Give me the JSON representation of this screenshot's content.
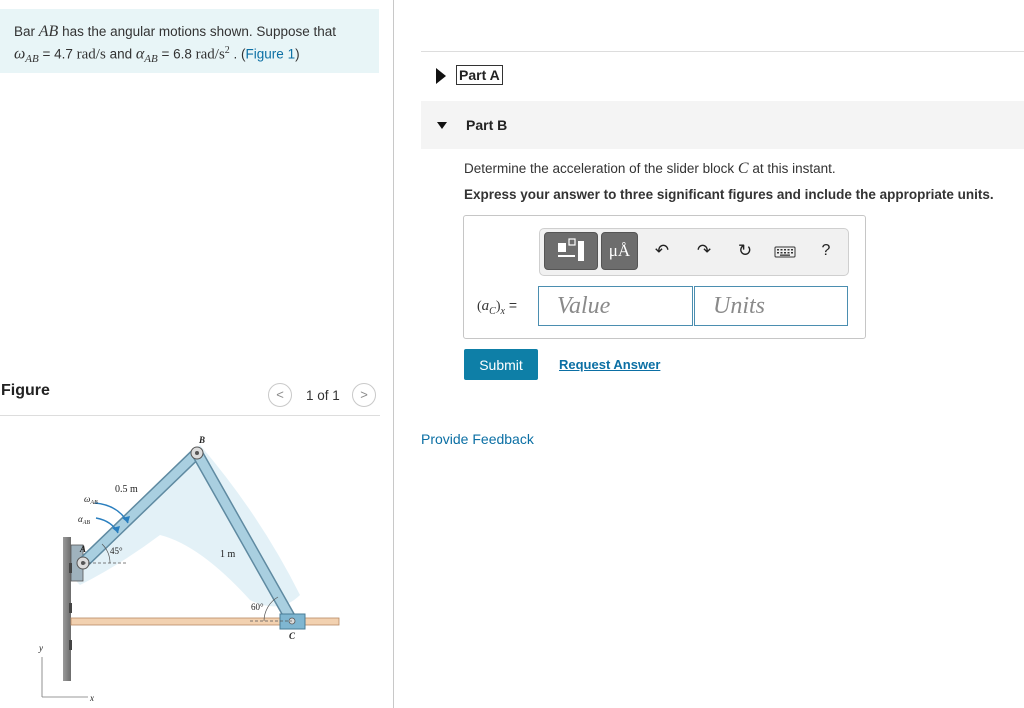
{
  "problem": {
    "text_1": "Bar ",
    "var_ab": "AB",
    "text_2": " has the angular motions shown. Suppose that",
    "omega_label": "ω",
    "omega_sub": "AB",
    "omega_value": " = 4.7 ",
    "omega_units": "rad/s",
    "and_text": " and ",
    "alpha_label": "α",
    "alpha_sub": "AB",
    "alpha_value": " = 6.8 ",
    "alpha_units": "rad/s",
    "alpha_units_exp": "2",
    "figure_link_prefix": " . (",
    "figure_link": "Figure 1",
    "figure_link_suffix": ")"
  },
  "figure_panel": {
    "heading": "Figure",
    "pager_prev": "<",
    "pager_text": "1 of 1",
    "pager_next": ">",
    "labels": {
      "b": "B",
      "a": "A",
      "c": "C",
      "y": "y",
      "x": "x",
      "len_ab": "0.5 m",
      "len_bc": "1 m",
      "angle_a": "45°",
      "angle_c": "60°",
      "omega": "ω",
      "omega_sub": "AB",
      "alpha": "α",
      "alpha_sub": "AB"
    }
  },
  "parts": {
    "part_a_label": "Part A",
    "part_b_label": "Part B"
  },
  "question": {
    "text_1": "Determine the acceleration of the slider block ",
    "var_c": "C",
    "text_2": " at this instant.",
    "instruction": "Express your answer to three significant figures and include the appropriate units."
  },
  "answer": {
    "label_open": "(",
    "label_a": "a",
    "label_sub": "C",
    "label_close": ")",
    "label_x": "x",
    "label_eq": " =",
    "value_placeholder": "Value",
    "units_placeholder": "Units",
    "toolbar": {
      "units_glyph": "μÅ",
      "undo_glyph": "↶",
      "redo_glyph": "↷",
      "reset_glyph": "↻",
      "help_glyph": "?"
    }
  },
  "actions": {
    "submit": "Submit",
    "request_answer": "Request Answer",
    "provide_feedback": "Provide Feedback"
  },
  "colors": {
    "accent": "#0e7fa7",
    "link": "#0b6fa4",
    "problem_bg": "#e8f5f7",
    "bar_fill": "#a9cfe0"
  }
}
